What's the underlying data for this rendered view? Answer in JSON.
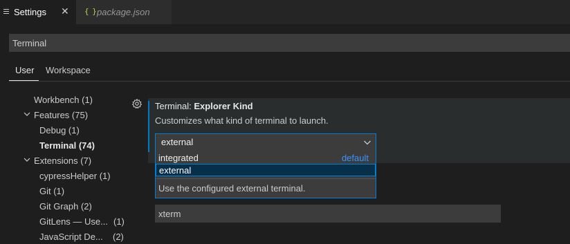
{
  "tabs": [
    {
      "label": "Settings",
      "close": "✕"
    },
    {
      "label": "package.json",
      "icon_text": "{ }"
    }
  ],
  "search": {
    "value": "Terminal"
  },
  "scope_tabs": [
    {
      "label": "User"
    },
    {
      "label": "Workspace"
    }
  ],
  "toc": [
    {
      "label": "Workbench (1)"
    },
    {
      "label": "Features (75)"
    },
    {
      "label": "Debug (1)"
    },
    {
      "label": "Terminal (74)"
    },
    {
      "label": "Extensions (7)"
    },
    {
      "label": "cypressHelper (1)"
    },
    {
      "label": "Git (1)"
    },
    {
      "label": "Git Graph (2)"
    },
    {
      "label": "GitLens — Use...",
      "count": "(1)"
    },
    {
      "label": "JavaScript De...",
      "count": "(2)"
    }
  ],
  "setting": {
    "category": "Terminal: ",
    "name": "Explorer Kind",
    "description": "Customizes what kind of terminal to launch.",
    "selected": "external",
    "options": [
      {
        "label": "integrated",
        "tag": "default"
      },
      {
        "label": "external"
      }
    ],
    "option_description": "Use the configured external terminal."
  },
  "next_setting": {
    "value": "xterm"
  },
  "colors": {
    "accent": "#007acc",
    "link": "#3794ff",
    "selection": "#062f4a"
  }
}
